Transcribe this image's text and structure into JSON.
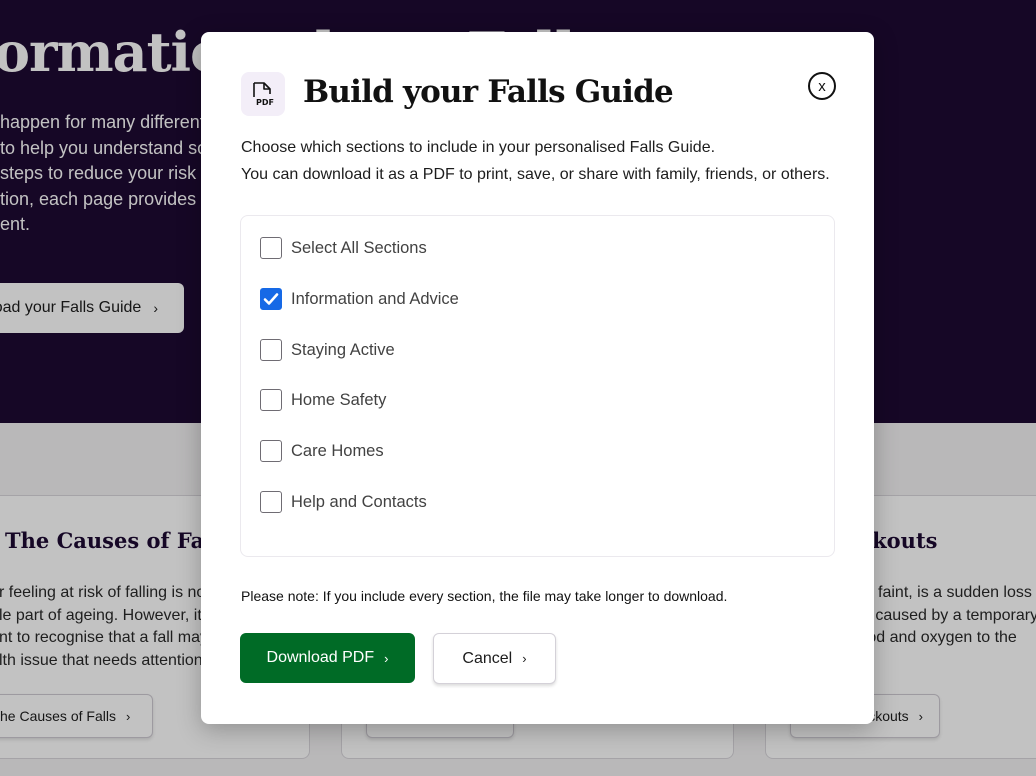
{
  "hero": {
    "title": "ormation about Falls",
    "lines": [
      "happen for many different reasons",
      "to help you understand some of these",
      "steps to reduce your risk of falling",
      "tion, each page provides advice and",
      "ent."
    ],
    "button_label": "oad your Falls Guide"
  },
  "cards": {
    "a": {
      "title": "The Causes of Falls",
      "lines": [
        "r feeling at risk of falling is not",
        "le part of ageing. However, it is",
        "nt to recognise that a fall may be",
        "lth issue that needs attention."
      ],
      "button_label": "he Causes of Falls"
    },
    "c": {
      "title": "Blackouts",
      "lines": [
        "or a faint, is a sudden loss",
        "ess caused by a temporary",
        "blood and oxygen to the"
      ],
      "button_label": "Blackouts"
    }
  },
  "modal": {
    "title": "Build your Falls Guide",
    "icon_text": "PDF",
    "close_label": "x",
    "intro": [
      "Choose which sections to include in your personalised Falls Guide.",
      "You can download it as a PDF to print, save, or share with family, friends, or others."
    ],
    "sections": [
      {
        "label": "Select All Sections",
        "checked": false
      },
      {
        "label": "Information and Advice",
        "checked": true
      },
      {
        "label": "Staying Active",
        "checked": false
      },
      {
        "label": "Home Safety",
        "checked": false
      },
      {
        "label": "Care Homes",
        "checked": false
      },
      {
        "label": "Help and Contacts",
        "checked": false
      }
    ],
    "note": "Please note: If you include every section, the file may take longer to download.",
    "download_label": "Download PDF",
    "cancel_label": "Cancel"
  },
  "colors": {
    "hero_bg": "#1d0a33",
    "primary_button": "#006b26",
    "checkbox_checked": "#1669e6"
  },
  "icons": [
    "pdf-file-icon",
    "close-icon",
    "checkmark-icon",
    "chevron-right-icon"
  ]
}
